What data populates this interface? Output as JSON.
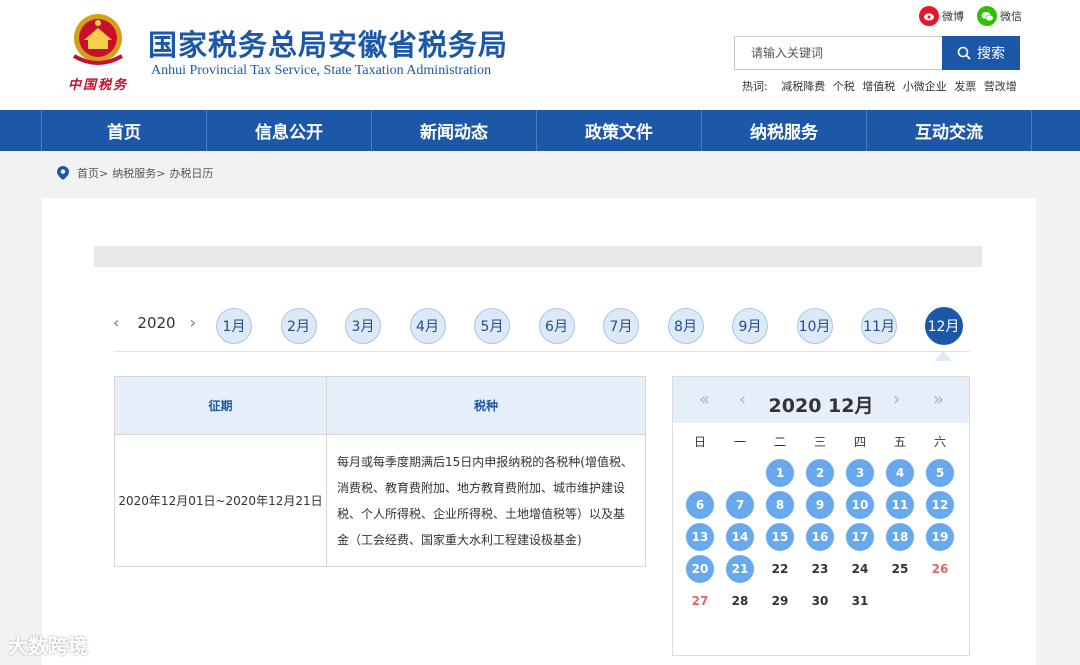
{
  "header": {
    "title": "国家税务总局安徽省税务局",
    "subtitle": "Anhui Provincial Tax Service, State Taxation Administration",
    "emblem_text": "中国税务",
    "weibo": "微博",
    "weixin": "微信",
    "search_placeholder": "请输入关键词",
    "search_button": "搜索",
    "hot_label": "热词:",
    "hot_words": [
      "减税降费",
      "个税",
      "增值税",
      "小微企业",
      "发票",
      "营改增"
    ]
  },
  "nav": [
    "首页",
    "信息公开",
    "新闻动态",
    "政策文件",
    "纳税服务",
    "互动交流"
  ],
  "breadcrumb": [
    "首页>",
    "纳税服务>",
    "办税日历"
  ],
  "year": "2020",
  "months": [
    "1月",
    "2月",
    "3月",
    "4月",
    "5月",
    "6月",
    "7月",
    "8月",
    "9月",
    "10月",
    "11月",
    "12月"
  ],
  "active_month": "12月",
  "table": {
    "headers": [
      "征期",
      "税种"
    ],
    "rows": [
      {
        "period": "2020年12月01日~2020年12月21日",
        "desc": "每月或每季度期满后15日内申报纳税的各税种(增值税、消费税、教育费附加、地方教育费附加、城市维护建设税、个人所得税、企业所得税、土地增值税等）以及基金（工会经费、国家重大水利工程建设极基金)"
      }
    ]
  },
  "calendar": {
    "title": "2020 12月",
    "weekdays": [
      "日",
      "一",
      "二",
      "三",
      "四",
      "五",
      "六"
    ],
    "first_weekday": 2,
    "days_in_month": 31,
    "tax_days_end": 21,
    "highlight_color": "#68a8ec",
    "weekend_color": "#e06666"
  },
  "colors": {
    "brand": "#1d58a8",
    "nav": "#1d58a8"
  },
  "watermark": "大数跨境"
}
